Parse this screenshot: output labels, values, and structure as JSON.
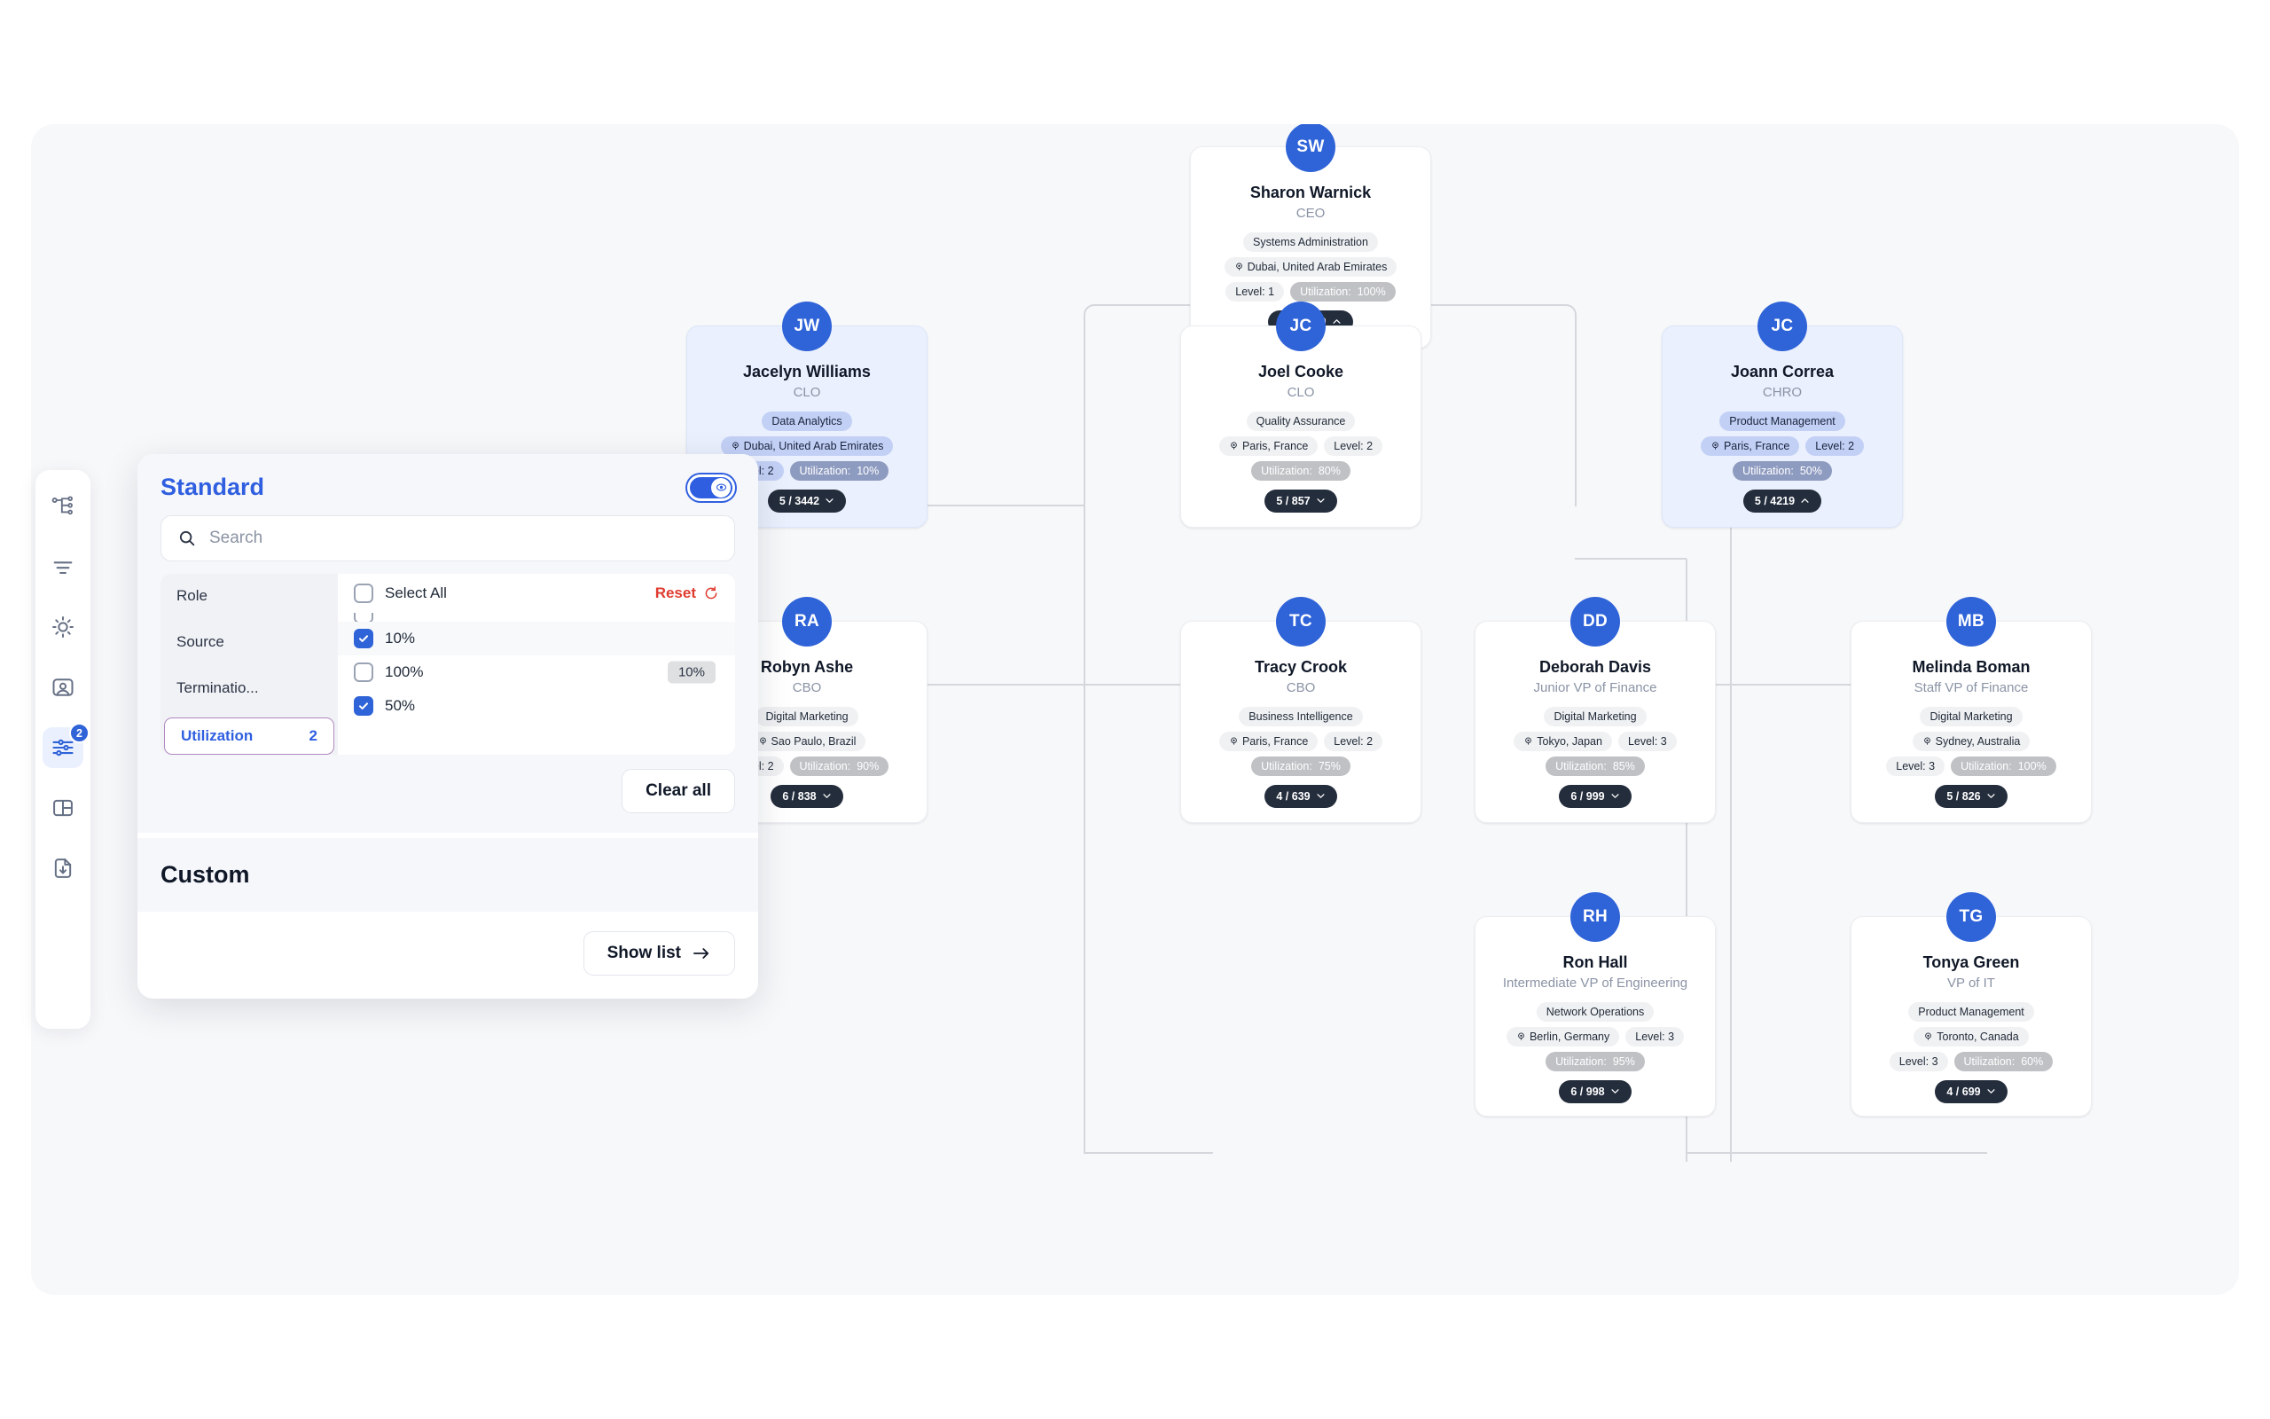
{
  "rail": {
    "items": [
      {
        "name": "org-chart-icon",
        "label": "Org chart"
      },
      {
        "name": "sort-lines-icon",
        "label": "Sort"
      },
      {
        "name": "sun-icon",
        "label": "Theme"
      },
      {
        "name": "profile-card-icon",
        "label": "Profile"
      },
      {
        "name": "sliders-icon",
        "label": "Filters",
        "badge": "2",
        "active": true
      },
      {
        "name": "layout-panel-icon",
        "label": "Layout"
      },
      {
        "name": "download-file-icon",
        "label": "Export"
      }
    ]
  },
  "panel": {
    "standard_title": "Standard",
    "custom_title": "Custom",
    "search_placeholder": "Search",
    "categories": [
      {
        "label": "Role",
        "count": "",
        "selected": false
      },
      {
        "label": "Source",
        "count": "",
        "selected": false
      },
      {
        "label": "Terminatio...",
        "count": "",
        "selected": false
      },
      {
        "label": "Utilization",
        "count": "2",
        "selected": true
      }
    ],
    "select_all_label": "Select All",
    "reset_label": "Reset",
    "options": [
      {
        "label": "10%",
        "checked": true,
        "tooltip": ""
      },
      {
        "label": "100%",
        "checked": false,
        "tooltip": "10%"
      },
      {
        "label": "50%",
        "checked": true,
        "tooltip": ""
      }
    ],
    "clear_all_label": "Clear all",
    "show_list_label": "Show list",
    "accent": "#2f5fe0",
    "reset_color": "#e03b2f",
    "selected_tab_border": "#b089c0"
  },
  "chart": {
    "nodes": [
      {
        "id": "sharon",
        "initials": "SW",
        "name": "Sharon Warnick",
        "title": "CEO",
        "department": "Systems Administration",
        "location": "Dubai, United Arab Emirates",
        "level": "Level: 1",
        "utilization_label": "Utilization:",
        "utilization_value": "100%",
        "count": "5 / 10000",
        "expanded": true,
        "highlighted": false
      },
      {
        "id": "jacelyn",
        "initials": "JW",
        "name": "Jacelyn Williams",
        "title": "CLO",
        "department": "Data Analytics",
        "location": "Dubai, United Arab Emirates",
        "level": "Level: 2",
        "utilization_label": "Utilization:",
        "utilization_value": "10%",
        "count": "5 / 3442",
        "expanded": false,
        "highlighted": true
      },
      {
        "id": "joel",
        "initials": "JC",
        "name": "Joel Cooke",
        "title": "CLO",
        "department": "Quality Assurance",
        "location": "Paris, France",
        "level": "Level: 2",
        "utilization_label": "Utilization:",
        "utilization_value": "80%",
        "count": "5 / 857",
        "expanded": false,
        "highlighted": false
      },
      {
        "id": "joann",
        "initials": "JC",
        "name": "Joann Correa",
        "title": "CHRO",
        "department": "Product Management",
        "location": "Paris, France",
        "level": "Level: 2",
        "utilization_label": "Utilization:",
        "utilization_value": "50%",
        "count": "5 / 4219",
        "expanded": true,
        "highlighted": true
      },
      {
        "id": "robyn",
        "initials": "RA",
        "name": "Robyn Ashe",
        "title": "CBO",
        "department": "Digital Marketing",
        "location": "Sao Paulo, Brazil",
        "level": "Level: 2",
        "utilization_label": "Utilization:",
        "utilization_value": "90%",
        "count": "6 / 838",
        "expanded": false,
        "highlighted": false
      },
      {
        "id": "tracy",
        "initials": "TC",
        "name": "Tracy Crook",
        "title": "CBO",
        "department": "Business Intelligence",
        "location": "Paris, France",
        "level": "Level: 2",
        "utilization_label": "Utilization:",
        "utilization_value": "75%",
        "count": "4 / 639",
        "expanded": false,
        "highlighted": false
      },
      {
        "id": "deborah",
        "initials": "DD",
        "name": "Deborah Davis",
        "title": "Junior VP of Finance",
        "department": "Digital Marketing",
        "location": "Tokyo, Japan",
        "level": "Level: 3",
        "utilization_label": "Utilization:",
        "utilization_value": "85%",
        "count": "6 / 999",
        "expanded": false,
        "highlighted": false
      },
      {
        "id": "melinda",
        "initials": "MB",
        "name": "Melinda Boman",
        "title": "Staff VP of Finance",
        "department": "Digital Marketing",
        "location": "Sydney, Australia",
        "level": "Level: 3",
        "utilization_label": "Utilization:",
        "utilization_value": "100%",
        "count": "5 / 826",
        "expanded": false,
        "highlighted": false
      },
      {
        "id": "ron",
        "initials": "RH",
        "name": "Ron Hall",
        "title": "Intermediate VP of Engineering",
        "department": "Network Operations",
        "location": "Berlin, Germany",
        "level": "Level: 3",
        "utilization_label": "Utilization:",
        "utilization_value": "95%",
        "count": "6 / 998",
        "expanded": false,
        "highlighted": false
      },
      {
        "id": "tonya",
        "initials": "TG",
        "name": "Tonya Green",
        "title": "VP of IT",
        "department": "Product Management",
        "location": "Toronto, Canada",
        "level": "Level: 3",
        "utilization_label": "Utilization:",
        "utilization_value": "60%",
        "count": "4 / 699",
        "expanded": false,
        "highlighted": false
      }
    ]
  }
}
